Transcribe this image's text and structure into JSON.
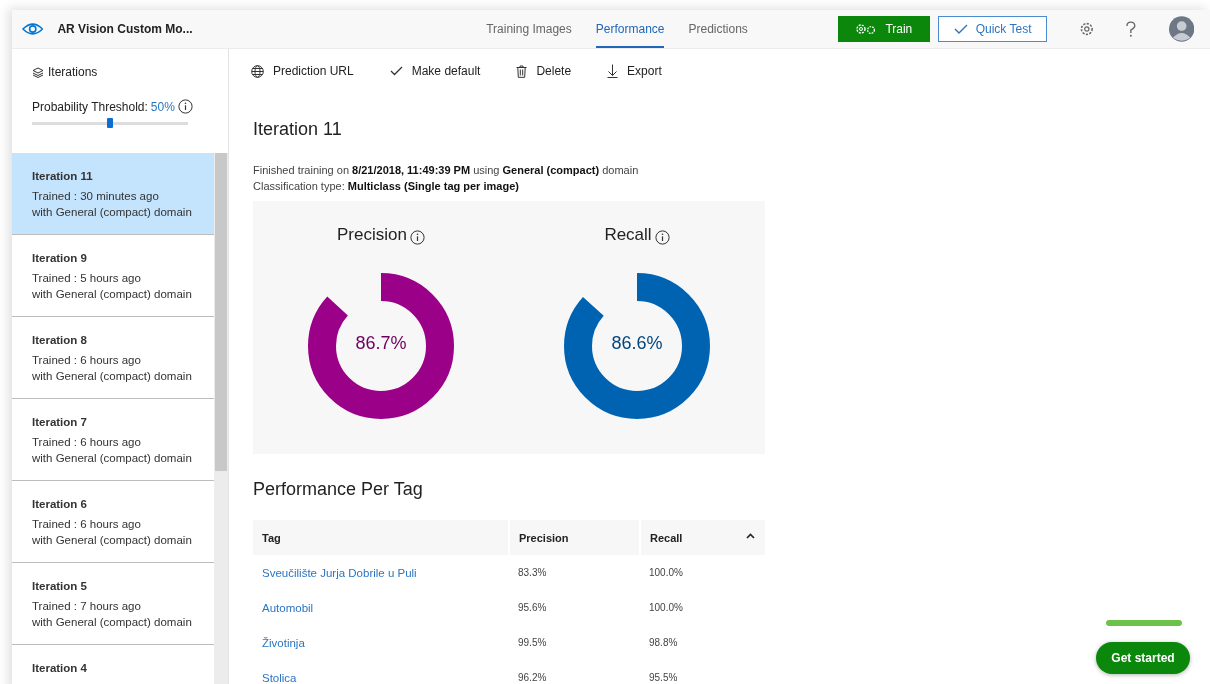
{
  "app": {
    "title": "AR Vision Custom Mo..."
  },
  "nav_tabs": [
    {
      "label": "Training Images",
      "selected": false
    },
    {
      "label": "Performance",
      "selected": true
    },
    {
      "label": "Predictions",
      "selected": false
    }
  ],
  "actions": {
    "train": "Train",
    "quick_test": "Quick Test"
  },
  "sidebar": {
    "heading": "Iterations",
    "threshold": {
      "label": "Probability Threshold:",
      "value": "50%",
      "level": 0.5
    },
    "items": [
      {
        "title": "Iteration 11",
        "trained": "Trained : 30 minutes ago",
        "domain": "with General (compact) domain",
        "selected": true
      },
      {
        "title": "Iteration 9",
        "trained": "Trained : 5 hours ago",
        "domain": "with General (compact) domain",
        "selected": false
      },
      {
        "title": "Iteration 8",
        "trained": "Trained : 6 hours ago",
        "domain": "with General (compact) domain",
        "selected": false
      },
      {
        "title": "Iteration 7",
        "trained": "Trained : 6 hours ago",
        "domain": "with General (compact) domain",
        "selected": false
      },
      {
        "title": "Iteration 6",
        "trained": "Trained : 6 hours ago",
        "domain": "with General (compact) domain",
        "selected": false
      },
      {
        "title": "Iteration 5",
        "trained": "Trained : 7 hours ago",
        "domain": "with General (compact) domain",
        "selected": false
      },
      {
        "title": "Iteration 4",
        "selected": false
      }
    ]
  },
  "toolbar": [
    {
      "kind": "globe",
      "label": "Prediction URL"
    },
    {
      "kind": "check",
      "label": "Make default"
    },
    {
      "kind": "trash",
      "label": "Delete"
    },
    {
      "kind": "download",
      "label": "Export"
    }
  ],
  "iteration": {
    "title": "Iteration 11",
    "details": [
      "Finished training on **8/21/2018, 11:49:39 PM** using **General (compact)** domain",
      "Classification type: **Multiclass (Single tag per image)**"
    ],
    "gauges": [
      {
        "label": "Precision",
        "value": "86.7%",
        "level": 0.867,
        "color": "#9b0088"
      },
      {
        "label": "Recall",
        "value": "86.6%",
        "level": 0.866,
        "color": "#0063b1"
      }
    ]
  },
  "per_tag": {
    "title": "Performance Per Tag",
    "columns": [
      "Tag",
      "Precision",
      "Recall"
    ],
    "rows": [
      {
        "tag": "Sveučilište Jurja Dobrile u Puli",
        "precision": "83.3%",
        "recall": "100.0%"
      },
      {
        "tag": "Automobil",
        "precision": "95.6%",
        "recall": "100.0%"
      },
      {
        "tag": "Životinja",
        "precision": "99.5%",
        "recall": "98.8%"
      },
      {
        "tag": "Stolica",
        "precision": "96.2%",
        "recall": "95.5%"
      }
    ]
  },
  "get_started": "Get started"
}
